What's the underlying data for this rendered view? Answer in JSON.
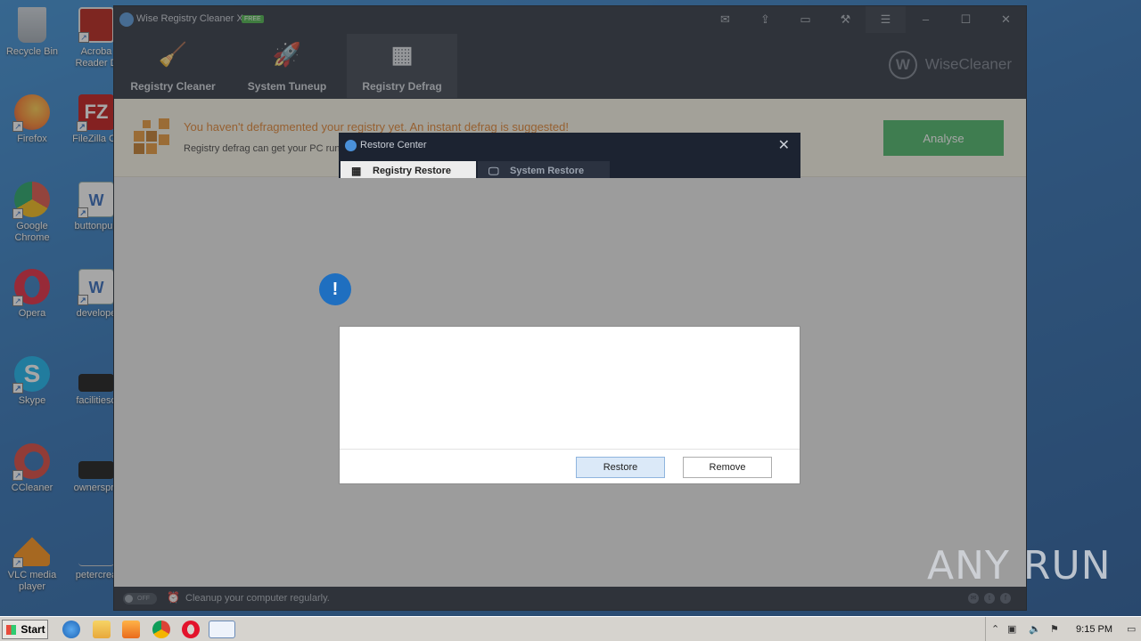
{
  "desktop": {
    "icons": [
      {
        "label": "Recycle Bin"
      },
      {
        "label": "Acroba Reader D"
      },
      {
        "label": "Firefox"
      },
      {
        "label": "FileZilla Cli"
      },
      {
        "label": "Google Chrome"
      },
      {
        "label": "buttonpub"
      },
      {
        "label": "Opera"
      },
      {
        "label": "develope"
      },
      {
        "label": "Skype"
      },
      {
        "label": "facilitieso"
      },
      {
        "label": "CCleaner"
      },
      {
        "label": "ownerspm"
      },
      {
        "label": "VLC media player"
      },
      {
        "label": "petercrea"
      }
    ]
  },
  "app": {
    "title": "Wise Registry Cleaner X",
    "badge": "FREE",
    "tabs": [
      {
        "label": "Registry Cleaner",
        "icon": "broom-icon"
      },
      {
        "label": "System Tuneup",
        "icon": "rocket-icon"
      },
      {
        "label": "Registry Defrag",
        "icon": "blocks-icon"
      }
    ],
    "brand": "WiseCleaner",
    "brand_letter": "W",
    "notice": {
      "headline": "You haven't defragmented your registry yet. An instant defrag is suggested!",
      "sub": "Registry defrag can get your PC run",
      "analyse_label": "Analyse"
    },
    "footer": {
      "toggle_label": "OFF",
      "tip": "Cleanup your computer regularly."
    }
  },
  "dialog": {
    "title": "Restore Center",
    "tabs": [
      {
        "label": "Registry Restore"
      },
      {
        "label": "System Restore"
      }
    ],
    "restore_label": "Restore",
    "remove_label": "Remove"
  },
  "watermark": "ANY RUN",
  "taskbar": {
    "start_label": "Start",
    "clock": "9:15 PM"
  },
  "colors": {
    "accent_orange": "#e07a1f",
    "analyse_green": "#3bb05a",
    "app_dark": "#1c2331"
  }
}
